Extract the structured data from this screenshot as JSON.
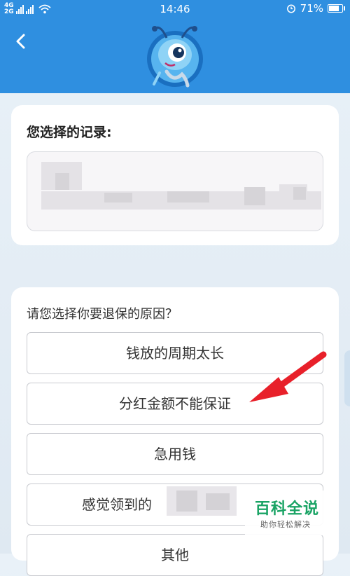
{
  "status_bar": {
    "network_top": "4G",
    "network_bottom": "2G",
    "time": "14:46",
    "battery": "71%"
  },
  "header": {
    "back_icon": "chevron-left-icon",
    "mascot_icon": "ant-mascot-icon",
    "color": "#2f8fe0"
  },
  "record_card": {
    "title": "您选择的记录:"
  },
  "reason_card": {
    "prompt": "请您选择你要退保的原因？",
    "options": [
      "钱放的周期太长",
      "分红金额不能保证",
      "急用钱",
      "感觉领到的",
      "其他"
    ]
  },
  "annotation": {
    "arrow_color": "#e8202a",
    "points_to": "分红金额不能保证"
  },
  "watermark": {
    "title": "百科全说",
    "subtitle": "助你轻松解决",
    "color": "#19a364"
  }
}
